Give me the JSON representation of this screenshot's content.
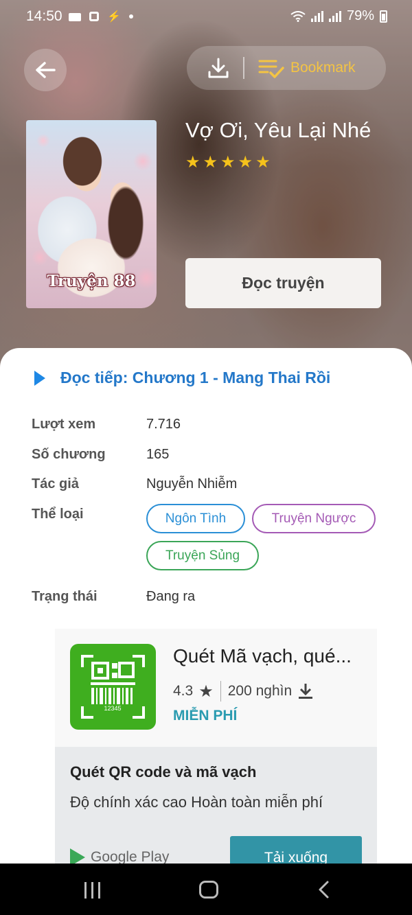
{
  "status_bar": {
    "time": "14:50",
    "battery": "79%"
  },
  "header": {
    "bookmark_label": "Bookmark"
  },
  "book": {
    "title": "Vợ Ơi, Yêu Lại Nhé",
    "rating_stars": 5,
    "cover_brand": "Truyện 88",
    "read_button": "Đọc truyện"
  },
  "continue_reading": "Đọc tiếp: Chương 1 - Mang Thai Rồi",
  "info": {
    "views_label": "Lượt xem",
    "views_value": "7.716",
    "chapters_label": "Số chương",
    "chapters_value": "165",
    "author_label": "Tác giả",
    "author_value": "Nguyễn Nhiễm",
    "genre_label": "Thể loại",
    "genres": [
      {
        "label": "Ngôn Tình",
        "color": "#2a8fd6"
      },
      {
        "label": "Truyện Ngược",
        "color": "#a45ab5"
      },
      {
        "label": "Truyện Sủng",
        "color": "#3aa557"
      }
    ],
    "status_label": "Trạng thái",
    "status_value": "Đang ra"
  },
  "ad": {
    "app_title": "Quét Mã vạch, qué...",
    "rating": "4.3",
    "installs": "200 nghìn",
    "price": "MIỄN PHÍ",
    "icon_digits": "12345",
    "headline": "Quét QR code và mã vạch",
    "description": "Độ chính xác cao Hoàn toàn miễn phí",
    "store_name": "Google Play",
    "cta": "Tải xuống"
  }
}
